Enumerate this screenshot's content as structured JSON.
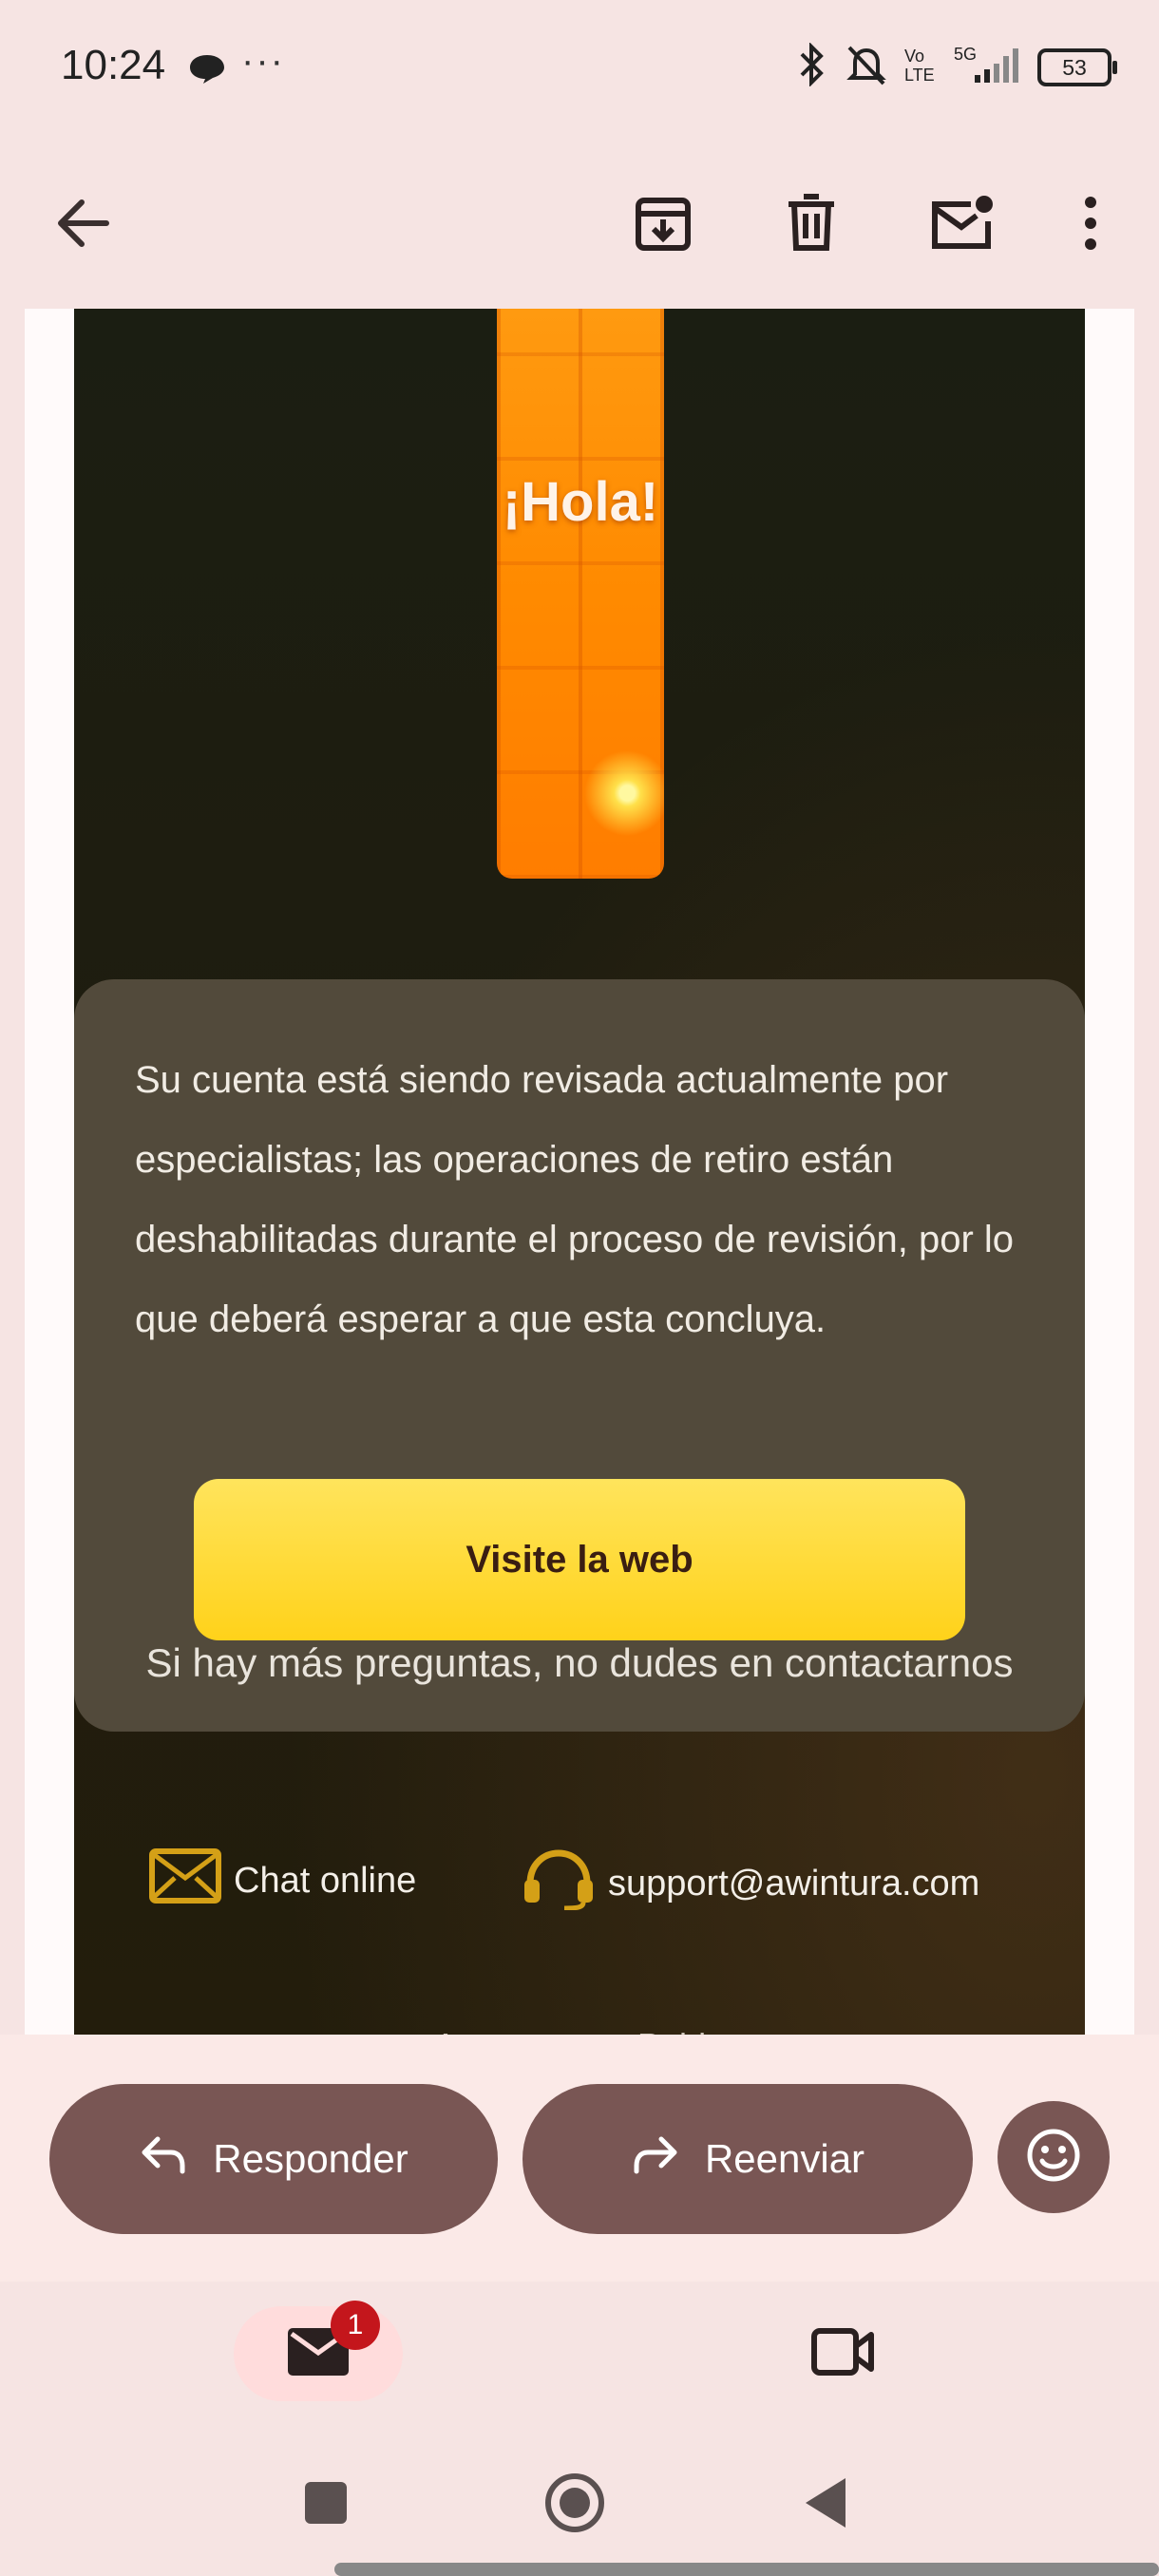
{
  "status_bar": {
    "time": "10:24",
    "overflow": "···",
    "battery": "53"
  },
  "toolbar": {
    "back": "back-arrow-icon",
    "archive": "archive-icon",
    "delete": "delete-icon",
    "mark_unread": "mark-unread-icon",
    "more": "more-vert-icon"
  },
  "email": {
    "hero_text": "¡Hola!",
    "body_text": "Su cuenta está siendo revisada actualmente por especialistas; las operaciones de retiro están deshabilitadas durante el proceso de revisión, por lo que deberá esperar a que esta concluya.",
    "cta_label": "Visite la web",
    "footer_line": "Si hay más preguntas, no dudes en contactarnos",
    "chat_label": "Chat online",
    "support_email": "support@awintura.com",
    "cut_off_text": "Atentamente Pablo"
  },
  "actions": {
    "reply": "Responder",
    "forward": "Reenviar"
  },
  "bottom_nav": {
    "mail_badge": "1"
  },
  "colors": {
    "accent_button": "#795654",
    "cta": "#ffd21a",
    "hero": "#ff8a00"
  }
}
